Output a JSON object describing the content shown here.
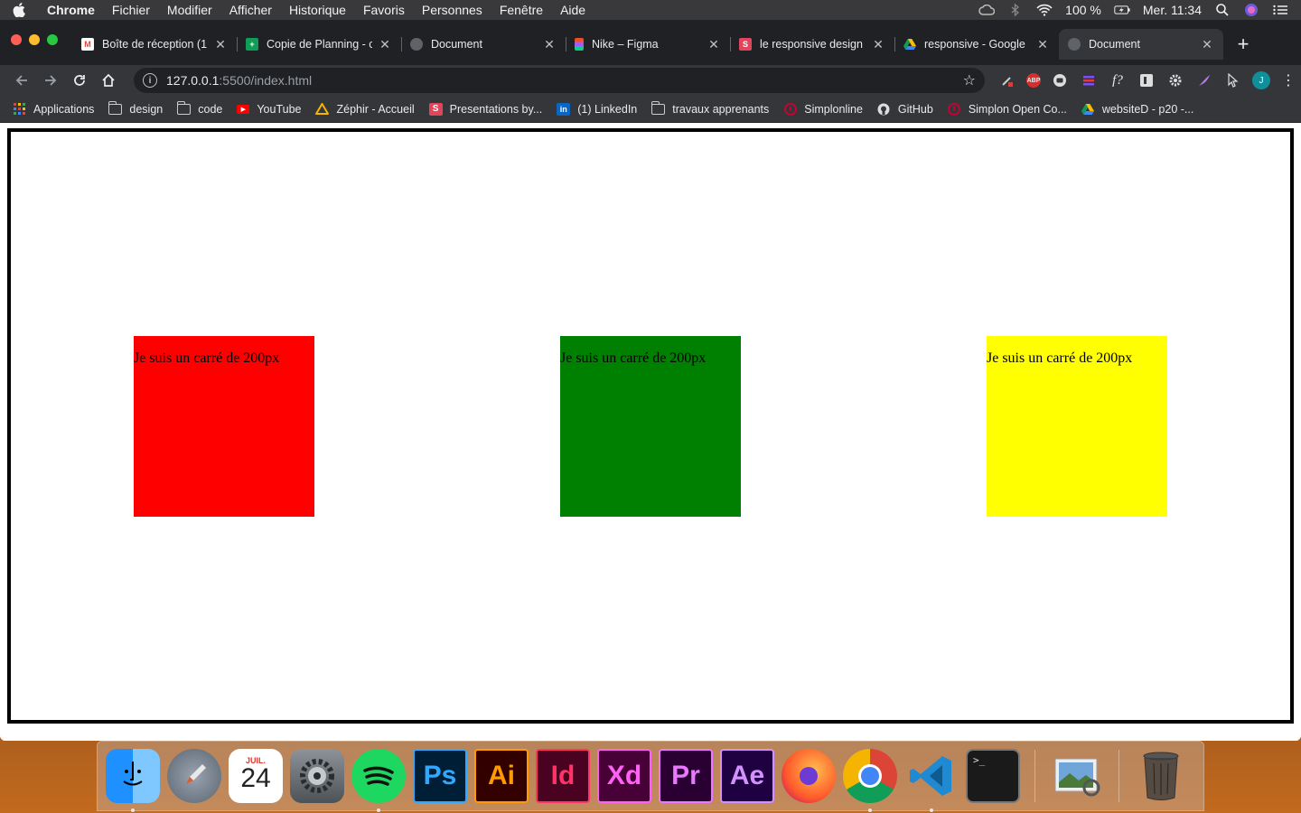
{
  "menubar": {
    "app_name": "Chrome",
    "items": [
      "Fichier",
      "Modifier",
      "Afficher",
      "Historique",
      "Favoris",
      "Personnes",
      "Fenêtre",
      "Aide"
    ],
    "battery": "100 %",
    "clock": "Mer. 11:34"
  },
  "tabs": [
    {
      "label": "Boîte de réception (1",
      "favicon": "gmail-icon",
      "color": "#ea4335",
      "active": false
    },
    {
      "label": "Copie de Planning - c",
      "favicon": "sheets-icon",
      "color": "#0f9d58",
      "active": false
    },
    {
      "label": "Document",
      "favicon": "globe-icon",
      "color": "#5f6368",
      "active": false
    },
    {
      "label": "Nike – Figma",
      "favicon": "figma-icon",
      "color": "#f24e1e",
      "active": false
    },
    {
      "label": "le responsive design",
      "favicon": "slides-icon",
      "color": "#e2445c",
      "active": false
    },
    {
      "label": "responsive - Google",
      "favicon": "drive-icon",
      "color": "#fbbc04",
      "active": false
    },
    {
      "label": "Document",
      "favicon": "globe-icon",
      "color": "#5f6368",
      "active": true
    }
  ],
  "address": {
    "host": "127.0.0.1",
    "path": ":5500/index.html"
  },
  "bookmarks": [
    {
      "label": "Applications",
      "icon": "apps-grid-icon"
    },
    {
      "label": "design",
      "icon": "folder-icon"
    },
    {
      "label": "code",
      "icon": "folder-icon"
    },
    {
      "label": "YouTube",
      "icon": "youtube-icon"
    },
    {
      "label": "Zéphir - Accueil",
      "icon": "zephir-icon"
    },
    {
      "label": "Presentations by...",
      "icon": "slides-icon"
    },
    {
      "label": "(1) LinkedIn",
      "icon": "linkedin-icon"
    },
    {
      "label": "travaux apprenants",
      "icon": "folder-icon"
    },
    {
      "label": "Simplonline",
      "icon": "simplon-icon"
    },
    {
      "label": "GitHub",
      "icon": "github-icon"
    },
    {
      "label": "Simplon Open Co...",
      "icon": "simplon-icon"
    },
    {
      "label": "websiteD - p20 -...",
      "icon": "drive-icon"
    }
  ],
  "extensions": {
    "abp": "ABP",
    "avatar_initial": "J"
  },
  "page": {
    "squares": [
      {
        "text": "Je suis un carré de 200px",
        "color": "#ff0000"
      },
      {
        "text": "Je suis un carré de 200px",
        "color": "#008000"
      },
      {
        "text": "Je suis un carré de 200px",
        "color": "#ffff00"
      }
    ]
  },
  "dock": {
    "calendar_month": "JUIL.",
    "calendar_day": "24",
    "apps": [
      {
        "name": "Ps",
        "bg": "#001e36",
        "fg": "#31a8ff"
      },
      {
        "name": "Ai",
        "bg": "#330000",
        "fg": "#ff9a00"
      },
      {
        "name": "Id",
        "bg": "#49021f",
        "fg": "#ff3366"
      },
      {
        "name": "Xd",
        "bg": "#470137",
        "fg": "#ff61f6"
      },
      {
        "name": "Pr",
        "bg": "#2a0033",
        "fg": "#ea77ff"
      },
      {
        "name": "Ae",
        "bg": "#1f0040",
        "fg": "#d291ff"
      }
    ],
    "terminal_prompt": ">_"
  }
}
